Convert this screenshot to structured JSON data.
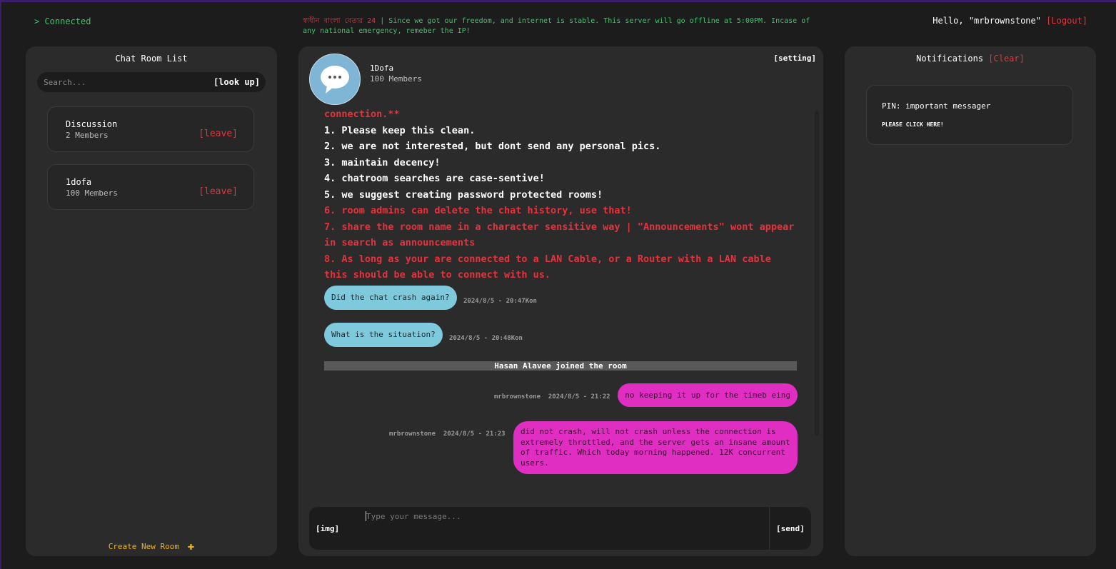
{
  "topbar": {
    "status": "> Connected",
    "announce_bn": "স্বাধীন বাংলা বেতার 24",
    "announce_text": " | Since we got our freedom, and internet is stable. This server will go offline at 5:00PM. Incase of any national emergency, remeber the IP!",
    "greeting": "Hello, \"mrbrownstone\"",
    "logout": "[Logout]"
  },
  "left": {
    "title": "Chat Room List",
    "search_placeholder": "Search...",
    "lookup": "[look up]",
    "rooms": [
      {
        "name": "Discussion",
        "members": "2 Members",
        "leave": "[leave]"
      },
      {
        "name": "1dofa",
        "members": "100 Members",
        "leave": "[leave]"
      }
    ],
    "create": "Create New Room"
  },
  "center": {
    "room_name": "1Dofa",
    "room_members": "100 Members",
    "setting": "[setting]",
    "rules": [
      {
        "text": "connection.**",
        "color": "red"
      },
      {
        "text": "1. Please keep this clean.",
        "color": "white"
      },
      {
        "text": "2. we are not interested, but dont send any personal pics.",
        "color": "white"
      },
      {
        "text": "3. maintain decency!",
        "color": "white"
      },
      {
        "text": "4. chatroom searches are case-sentive!",
        "color": "white"
      },
      {
        "text": "5. we suggest creating password protected rooms!",
        "color": "white"
      },
      {
        "text": "6. room admins can delete the chat history, use that!",
        "color": "red"
      },
      {
        "text": "7. share the room name in a character sensitive way | \"Announcements\" wont appear in search as announcements",
        "color": "red"
      },
      {
        "text": "8. As long as your are connected to a LAN Cable, or a Router with a LAN cable this should be able to connect with us.",
        "color": "red"
      }
    ],
    "messages_in": [
      {
        "text": "Did the chat crash again?",
        "time": "2024/8/5 - 20:47Kon"
      },
      {
        "text": "What is the situation?",
        "time": "2024/8/5 - 20:48Kon"
      }
    ],
    "joined": "Hasan Alavee joined the room",
    "messages_out": [
      {
        "user": "mrbrownstone",
        "time": "2024/8/5 - 21:22",
        "text": "no keeping it up for the timeb eing"
      },
      {
        "user": "mrbrownstone",
        "time": "2024/8/5 - 21:23",
        "text": "did not crash, will not crash unless the connection is extremely throttled, and the server gets an insane amount of traffic. Which today morning happened. 12K concurrent users."
      }
    ],
    "composer": {
      "img": "[img]",
      "placeholder": "Type your message...",
      "send": "[send]"
    }
  },
  "right": {
    "title": "Notifications",
    "clear": "[Clear]",
    "notifications": [
      {
        "title": "PIN: important messager",
        "action": "PLEASE CLICK HERE!"
      }
    ]
  },
  "colors": {
    "background": "#1c1c1c",
    "panel": "#2b2b2b",
    "status_green": "#3fc46a",
    "alert_red": "#e5323d",
    "incoming_bubble": "#7ec9db",
    "outgoing_bubble": "#e02ec3",
    "create_yellow": "#f2b21b"
  }
}
